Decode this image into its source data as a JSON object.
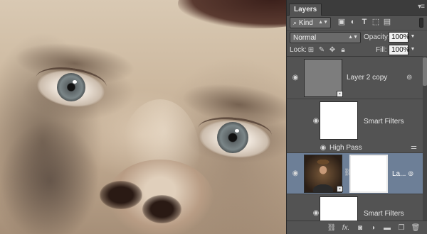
{
  "panel": {
    "tab_label": "Layers",
    "filter": {
      "kind_label": "Kind",
      "filter_icons": [
        "image-filter-icon",
        "adjustment-filter-icon",
        "type-filter-icon",
        "shape-filter-icon",
        "smart-object-filter-icon"
      ]
    },
    "blend_mode": "Normal",
    "opacity_label": "Opacity:",
    "opacity_value": "100%",
    "lock_label": "Lock:",
    "fill_label": "Fill:",
    "fill_value": "100%",
    "layers": [
      {
        "name": "Layer 2 copy",
        "thumbnail": "gray",
        "smart_object": true,
        "selected": false
      },
      {
        "name": "Smart Filters",
        "thumbnail": "white-mask",
        "selected": false
      },
      {
        "name": "High Pass",
        "type": "filter",
        "selected": false
      },
      {
        "name": "La...",
        "thumbnail": "portrait",
        "mask": true,
        "selected": true
      },
      {
        "name": "Smart Filters",
        "thumbnail": "white-mask",
        "selected": false
      }
    ],
    "footer_icons": [
      "link-icon",
      "fx-icon",
      "mask-icon",
      "adjustment-icon",
      "group-folder-icon",
      "new-layer-icon",
      "trash-icon"
    ],
    "footer_fx": "fx."
  },
  "colors": {
    "panel_bg": "#535353",
    "selected_row": "#6d7f97",
    "tabbar": "#3c3c3c"
  }
}
